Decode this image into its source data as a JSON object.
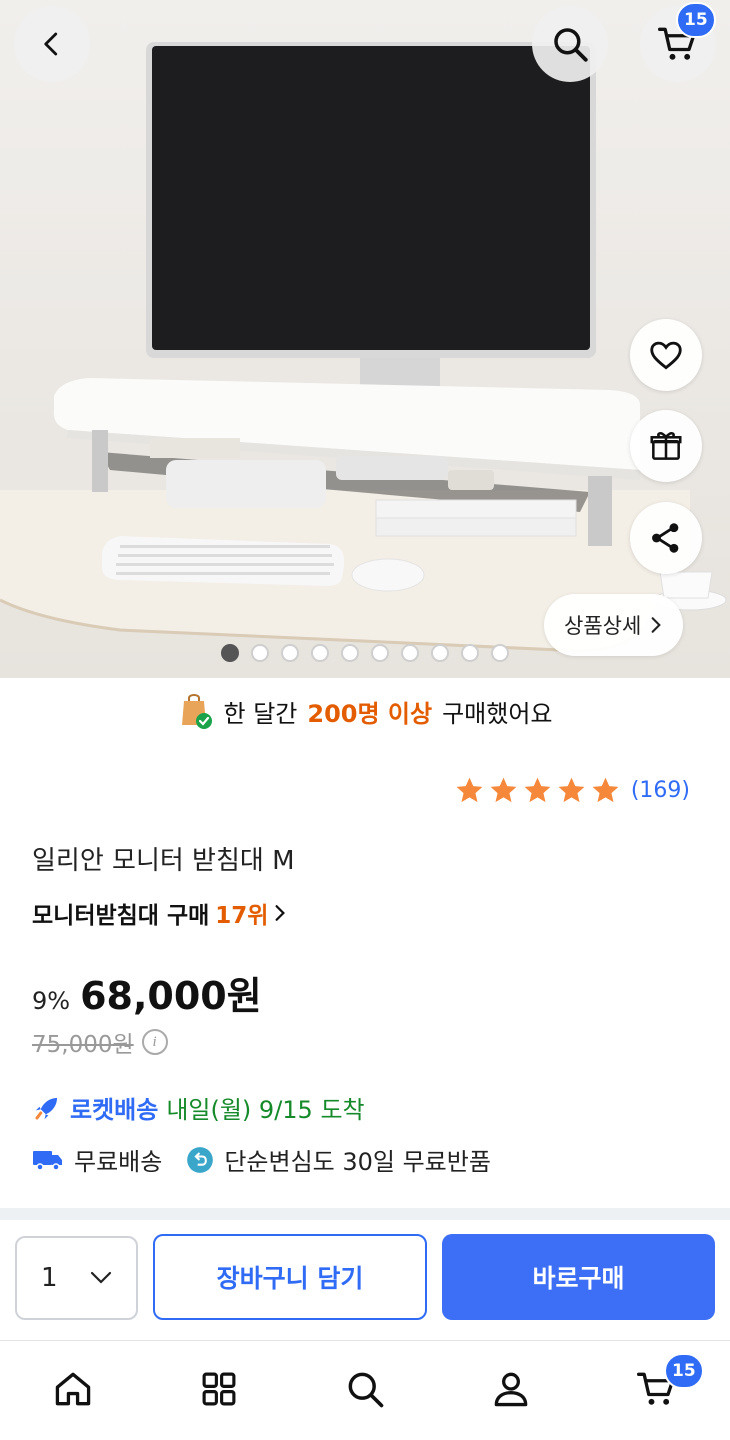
{
  "header": {
    "back_icon": "chevron-left-icon",
    "search_icon": "search-icon",
    "cart_icon": "cart-icon",
    "cart_badge": "15"
  },
  "hero": {
    "side_actions": [
      "heart-icon",
      "gift-icon",
      "share-icon"
    ],
    "detail_button": "상품상세",
    "carousel": {
      "total": 10,
      "active": 1
    }
  },
  "social_proof": {
    "prefix": "한 달간",
    "highlight": "200명 이상",
    "suffix": "구매했어요"
  },
  "rating": {
    "stars": 5,
    "count": "(169)",
    "star_color": "#f5883a"
  },
  "product": {
    "title": "일리안 모니터 받침대 M",
    "rank_prefix": "모니터받침대 구매",
    "rank": "17위"
  },
  "price": {
    "discount": "9%",
    "sale": "68,000원",
    "original": "75,000원"
  },
  "delivery": {
    "brand": "로켓배송",
    "eta": "내일(월) 9/15 도착",
    "free_shipping": "무료배송",
    "returns": "단순변심도 30일 무료반품"
  },
  "purchase": {
    "quantity": "1",
    "add_to_cart": "장바구니 담기",
    "buy_now": "바로구매"
  },
  "bottom_nav": {
    "items": [
      "home-icon",
      "categories-icon",
      "search-icon",
      "profile-icon",
      "cart-icon"
    ],
    "cart_badge": "15"
  },
  "colors": {
    "brand_blue": "#2f6bf5",
    "accent_orange": "#e35d00",
    "eta_green": "#168a2a"
  }
}
